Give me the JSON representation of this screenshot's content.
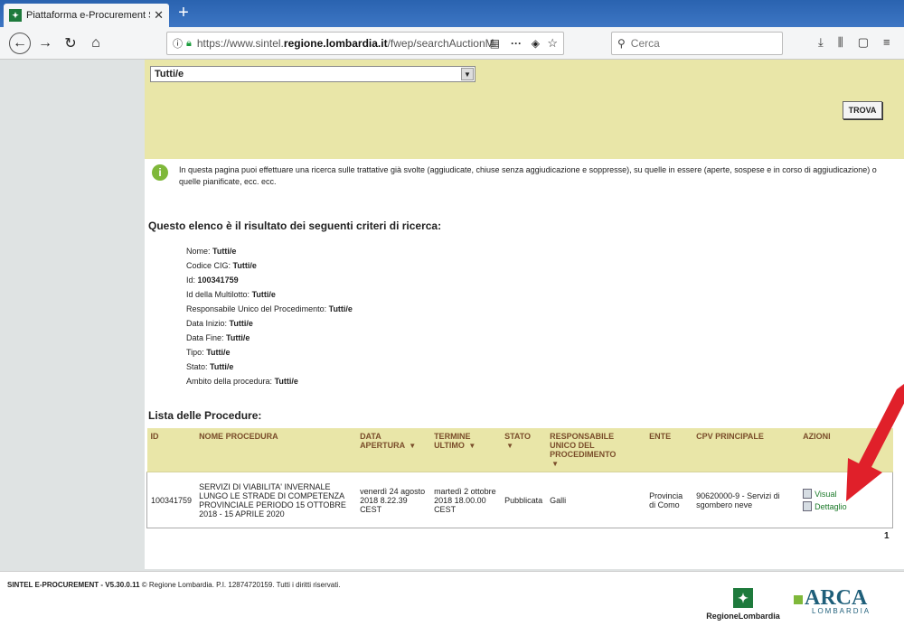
{
  "browser": {
    "tab_title": "Piattaforma e-Procurement Si",
    "url_prefix": "https://www.sintel.",
    "url_domain": "regione.lombardia.it",
    "url_path": "/fwep/searchAuctionMark",
    "search_placeholder": "Cerca"
  },
  "filter": {
    "select_value": "Tutti/e",
    "search_button": "TROVA"
  },
  "info": {
    "text": "In questa pagina puoi effettuare una ricerca sulle trattative già svolte (aggiudicate, chiuse senza aggiudicazione e soppresse), su quelle in essere (aperte, sospese e in corso di aggiudicazione) o quelle pianificate, ecc. ecc."
  },
  "criteria": {
    "title": "Questo elenco è il risultato dei seguenti criteri di ricerca:",
    "items": [
      {
        "label": "Nome:",
        "value": "Tutti/e"
      },
      {
        "label": "Codice CIG:",
        "value": "Tutti/e"
      },
      {
        "label": "Id:",
        "value": "100341759"
      },
      {
        "label": "Id della Multilotto:",
        "value": "Tutti/e"
      },
      {
        "label": "Responsabile Unico del Procedimento:",
        "value": "Tutti/e"
      },
      {
        "label": "Data Inizio:",
        "value": "Tutti/e"
      },
      {
        "label": "Data Fine:",
        "value": "Tutti/e"
      },
      {
        "label": "Tipo:",
        "value": "Tutti/e"
      },
      {
        "label": "Stato:",
        "value": "Tutti/e"
      },
      {
        "label": "Ambito della procedura:",
        "value": "Tutti/e"
      }
    ]
  },
  "list": {
    "title": "Lista delle Procedure:",
    "headers": [
      "ID",
      "NOME PROCEDURA",
      "DATA APERTURA",
      "TERMINE ULTIMO",
      "STATO",
      "RESPONSABILE UNICO DEL PROCEDIMENTO",
      "ENTE",
      "CPV PRINCIPALE",
      "AZIONI"
    ],
    "rows": [
      {
        "id": "100341759",
        "nome": "SERVIZI DI VIABILITA' INVERNALE LUNGO LE STRADE DI COMPETENZA PROVINCIALE PERIODO 15 OTTOBRE 2018 - 15 APRILE 2020",
        "data_apertura": "venerdì 24 agosto 2018 8.22.39 CEST",
        "termine_ultimo": "martedì 2 ottobre 2018 18.00.00 CEST",
        "stato": "Pubblicata",
        "responsabile": "Galli",
        "ente": "Provincia di Como",
        "cpv": "90620000-9 - Servizi di sgombero neve",
        "action_view": "Visual",
        "action_detail": "Dettaglio"
      }
    ],
    "page": "1"
  },
  "footer": {
    "brand": "SINTEL E-PROCUREMENT - V5.30.0.11",
    "text": " © Regione Lombardia. P.I. 12874720159. Tutti i diritti riservati.",
    "logo_rl": "RegioneLombardia",
    "logo_arca": "ARCA",
    "logo_arca_sub": "LOMBARDIA"
  },
  "colors": {
    "filter_bg": "#e9e6a8",
    "header_text": "#7a4d2a",
    "link": "#1c7a2a",
    "arrow": "#e0202a"
  }
}
